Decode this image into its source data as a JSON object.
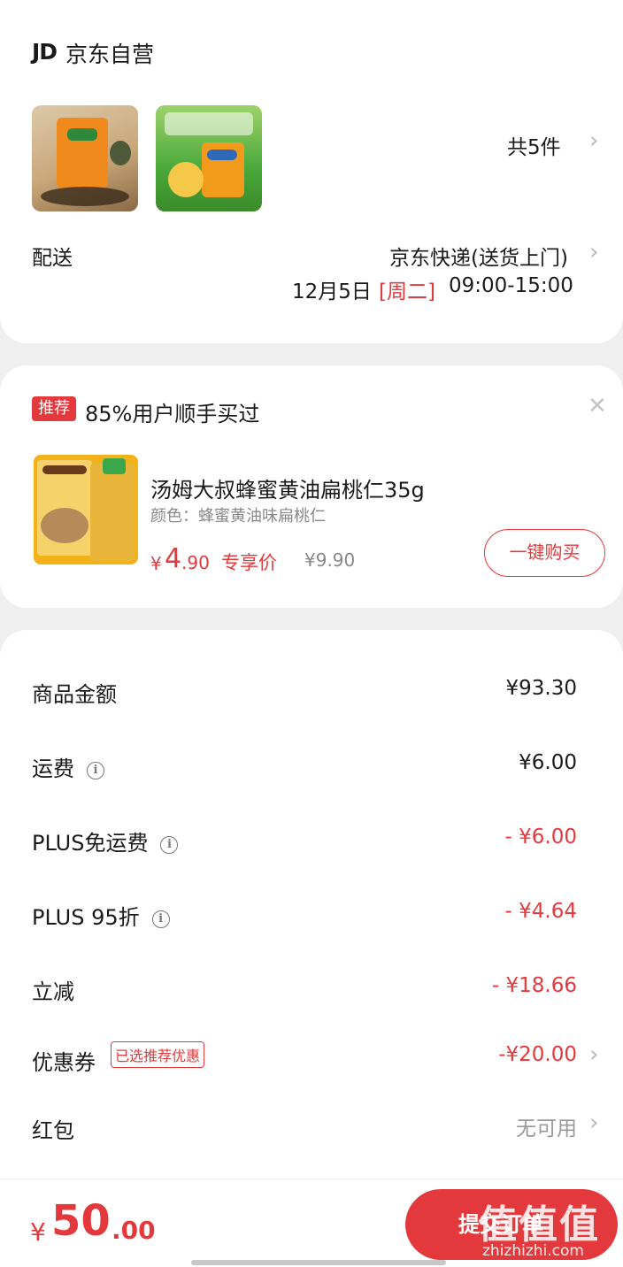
{
  "store": {
    "logo": "JD",
    "name": "京东自营",
    "item_count": "共5件",
    "delivery_label": "配送",
    "delivery_method": "京东快递(送货上门)",
    "delivery_date": "12月5日",
    "delivery_weekday": "[周二]",
    "delivery_time": "09:00-15:00"
  },
  "recommend": {
    "tag": "推荐",
    "headline": "85%用户顺手买过",
    "product_title": "汤姆大叔蜂蜜黄油扁桃仁35g",
    "product_color": "颜色：蜂蜜黄油味扁桃仁",
    "price_currency": "¥",
    "price_int": "4",
    "price_dec": ".90",
    "price_label": "专享价",
    "original_price": "¥9.90",
    "buy_button": "一键购买"
  },
  "summary": {
    "rows": [
      {
        "label": "商品金额",
        "value": "¥93.30"
      },
      {
        "label": "运费",
        "value": "¥6.00"
      },
      {
        "label": "PLUS免运费",
        "value": "- ¥6.00"
      },
      {
        "label": "PLUS 95折",
        "value": "- ¥4.64"
      },
      {
        "label": "立减",
        "value": "- ¥18.66"
      },
      {
        "label": "优惠券",
        "value": "-¥20.00",
        "badge": "已选推荐优惠"
      },
      {
        "label": "红包",
        "value": "无可用"
      }
    ]
  },
  "footer": {
    "total_currency": "¥",
    "total_int": "50",
    "total_dec": ".00",
    "submit_label": "提交订单",
    "watermark": "值值值",
    "watermark_url": "zhizhizhi.com"
  },
  "colors": {
    "accent": "#e4393c",
    "background": "#efefef"
  }
}
